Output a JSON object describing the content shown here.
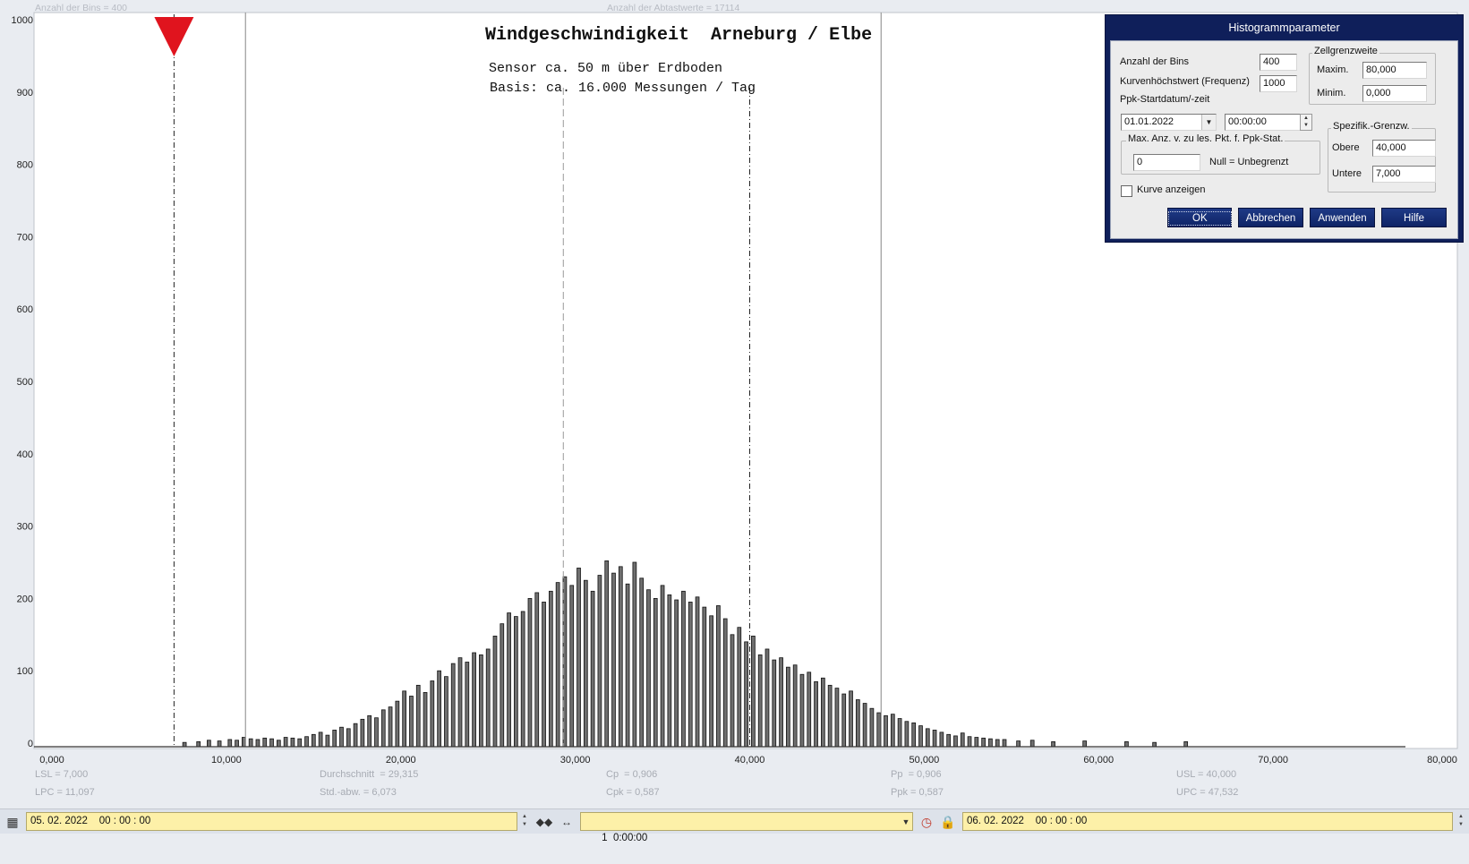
{
  "header": {
    "bins_label": "Anzahl der Bins =   400",
    "samples_label": "Anzahl der Abtastwerte = 17114"
  },
  "chart_data": {
    "type": "bar",
    "title": "Windgeschwindigkeit  Arneburg / Elbe",
    "subtitle_lines": [
      "Sensor ca. 50 m über Erdboden",
      "Basis: ca. 16.000 Messungen / Tag"
    ],
    "y_ticks": [
      "1000",
      "900",
      "800",
      "700",
      "600",
      "500",
      "400",
      "300",
      "200",
      "100",
      "0"
    ],
    "x_ticks": [
      "0,000",
      "10,000",
      "20,000",
      "30,000",
      "40,000",
      "50,000",
      "60,000",
      "70,000",
      "80,000"
    ],
    "xlim": [
      0,
      80
    ],
    "ylim": [
      0,
      1000
    ],
    "bin_width": 0.2,
    "bins": [
      {
        "x": 7.5,
        "y": 1
      },
      {
        "x": 8.3,
        "y": 2
      },
      {
        "x": 8.9,
        "y": 4
      },
      {
        "x": 9.5,
        "y": 3
      },
      {
        "x": 10.1,
        "y": 5
      },
      {
        "x": 10.5,
        "y": 4
      },
      {
        "x": 10.9,
        "y": 8
      },
      {
        "x": 11.3,
        "y": 6
      },
      {
        "x": 11.7,
        "y": 5
      },
      {
        "x": 12.1,
        "y": 7
      },
      {
        "x": 12.5,
        "y": 6
      },
      {
        "x": 12.9,
        "y": 4
      },
      {
        "x": 13.3,
        "y": 8
      },
      {
        "x": 13.7,
        "y": 7
      },
      {
        "x": 14.1,
        "y": 6
      },
      {
        "x": 14.5,
        "y": 9
      },
      {
        "x": 14.9,
        "y": 12
      },
      {
        "x": 15.3,
        "y": 15
      },
      {
        "x": 15.7,
        "y": 11
      },
      {
        "x": 16.1,
        "y": 18
      },
      {
        "x": 16.5,
        "y": 22
      },
      {
        "x": 16.9,
        "y": 20
      },
      {
        "x": 17.3,
        "y": 27
      },
      {
        "x": 17.7,
        "y": 33
      },
      {
        "x": 18.1,
        "y": 38
      },
      {
        "x": 18.5,
        "y": 35
      },
      {
        "x": 18.9,
        "y": 46
      },
      {
        "x": 19.3,
        "y": 50
      },
      {
        "x": 19.7,
        "y": 58
      },
      {
        "x": 20.1,
        "y": 72
      },
      {
        "x": 20.5,
        "y": 65
      },
      {
        "x": 20.9,
        "y": 80
      },
      {
        "x": 21.3,
        "y": 70
      },
      {
        "x": 21.7,
        "y": 86
      },
      {
        "x": 22.1,
        "y": 100
      },
      {
        "x": 22.5,
        "y": 92
      },
      {
        "x": 22.9,
        "y": 110
      },
      {
        "x": 23.3,
        "y": 118
      },
      {
        "x": 23.7,
        "y": 112
      },
      {
        "x": 24.1,
        "y": 125
      },
      {
        "x": 24.5,
        "y": 122
      },
      {
        "x": 24.9,
        "y": 130
      },
      {
        "x": 25.3,
        "y": 148
      },
      {
        "x": 25.7,
        "y": 165
      },
      {
        "x": 26.1,
        "y": 180
      },
      {
        "x": 26.5,
        "y": 175
      },
      {
        "x": 26.9,
        "y": 182
      },
      {
        "x": 27.3,
        "y": 200
      },
      {
        "x": 27.7,
        "y": 208
      },
      {
        "x": 28.1,
        "y": 195
      },
      {
        "x": 28.5,
        "y": 210
      },
      {
        "x": 28.9,
        "y": 222
      },
      {
        "x": 29.3,
        "y": 230
      },
      {
        "x": 29.7,
        "y": 218
      },
      {
        "x": 30.1,
        "y": 242
      },
      {
        "x": 30.5,
        "y": 225
      },
      {
        "x": 30.9,
        "y": 210
      },
      {
        "x": 31.3,
        "y": 232
      },
      {
        "x": 31.7,
        "y": 252
      },
      {
        "x": 32.1,
        "y": 235
      },
      {
        "x": 32.5,
        "y": 244
      },
      {
        "x": 32.9,
        "y": 220
      },
      {
        "x": 33.3,
        "y": 250
      },
      {
        "x": 33.7,
        "y": 228
      },
      {
        "x": 34.1,
        "y": 212
      },
      {
        "x": 34.5,
        "y": 200
      },
      {
        "x": 34.9,
        "y": 218
      },
      {
        "x": 35.3,
        "y": 205
      },
      {
        "x": 35.7,
        "y": 198
      },
      {
        "x": 36.1,
        "y": 210
      },
      {
        "x": 36.5,
        "y": 195
      },
      {
        "x": 36.9,
        "y": 202
      },
      {
        "x": 37.3,
        "y": 188
      },
      {
        "x": 37.7,
        "y": 176
      },
      {
        "x": 38.1,
        "y": 190
      },
      {
        "x": 38.5,
        "y": 172
      },
      {
        "x": 38.9,
        "y": 150
      },
      {
        "x": 39.3,
        "y": 160
      },
      {
        "x": 39.7,
        "y": 140
      },
      {
        "x": 40.1,
        "y": 148
      },
      {
        "x": 40.5,
        "y": 122
      },
      {
        "x": 40.9,
        "y": 130
      },
      {
        "x": 41.3,
        "y": 115
      },
      {
        "x": 41.7,
        "y": 118
      },
      {
        "x": 42.1,
        "y": 105
      },
      {
        "x": 42.5,
        "y": 108
      },
      {
        "x": 42.9,
        "y": 95
      },
      {
        "x": 43.3,
        "y": 98
      },
      {
        "x": 43.7,
        "y": 85
      },
      {
        "x": 44.1,
        "y": 90
      },
      {
        "x": 44.5,
        "y": 80
      },
      {
        "x": 44.9,
        "y": 76
      },
      {
        "x": 45.3,
        "y": 68
      },
      {
        "x": 45.7,
        "y": 72
      },
      {
        "x": 46.1,
        "y": 60
      },
      {
        "x": 46.5,
        "y": 55
      },
      {
        "x": 46.9,
        "y": 48
      },
      {
        "x": 47.3,
        "y": 42
      },
      {
        "x": 47.7,
        "y": 38
      },
      {
        "x": 48.1,
        "y": 40
      },
      {
        "x": 48.5,
        "y": 34
      },
      {
        "x": 48.9,
        "y": 30
      },
      {
        "x": 49.3,
        "y": 28
      },
      {
        "x": 49.7,
        "y": 24
      },
      {
        "x": 50.1,
        "y": 20
      },
      {
        "x": 50.5,
        "y": 18
      },
      {
        "x": 50.9,
        "y": 15
      },
      {
        "x": 51.3,
        "y": 12
      },
      {
        "x": 51.7,
        "y": 10
      },
      {
        "x": 52.1,
        "y": 14
      },
      {
        "x": 52.5,
        "y": 9
      },
      {
        "x": 52.9,
        "y": 8
      },
      {
        "x": 53.3,
        "y": 7
      },
      {
        "x": 53.7,
        "y": 6
      },
      {
        "x": 54.1,
        "y": 5
      },
      {
        "x": 54.5,
        "y": 5
      },
      {
        "x": 55.3,
        "y": 3
      },
      {
        "x": 56.1,
        "y": 4
      },
      {
        "x": 57.3,
        "y": 2
      },
      {
        "x": 59.1,
        "y": 3
      },
      {
        "x": 61.5,
        "y": 2
      },
      {
        "x": 63.1,
        "y": 1
      },
      {
        "x": 64.9,
        "y": 2
      }
    ],
    "lines": {
      "lsl": 7.0,
      "lpc": 11.097,
      "mean": 29.315,
      "usl": 40.0,
      "upc": 47.532
    },
    "marker_value": 7.0,
    "colors": {
      "bar_fill": "#6f6f6f",
      "bar_stroke": "#111111",
      "marker": "#e0141e",
      "axis": "#333333"
    }
  },
  "stats": {
    "lsl": "LSL = 7,000",
    "lpc": "LPC = 11,097",
    "mean": "Durchschnitt  = 29,315",
    "std": "Std.-abw. = 6,073",
    "cp": "Cp  = 0,906",
    "cpk": "Cpk = 0,587",
    "pp": "Pp  = 0,906",
    "ppk": "Ppk = 0,587",
    "usl": "USL = 40,000",
    "upc": "UPC = 47,532"
  },
  "dialog": {
    "title": "Histogrammparameter",
    "bins_label": "Anzahl der Bins",
    "bins_value": "400",
    "max_freq_label": "Kurvenhöchstwert (Frequenz)",
    "max_freq_value": "1000",
    "ppk_start_label": "Ppk-Startdatum/-zeit",
    "start_date": "01.01.2022",
    "start_time": "00:00:00",
    "cell_group_label": "Zellgrenzweite",
    "max_label": "Maxim.",
    "max_value": "80,000",
    "min_label": "Minim.",
    "min_value": "0,000",
    "maxpts_group_label": "Max. Anz. v. zu les. Pkt. f. Ppk-Stat.",
    "maxpts_value": "0",
    "maxpts_hint": "Null = Unbegrenzt",
    "spec_group_label": "Spezifik.-Grenzw.",
    "upper_label": "Obere",
    "upper_value": "40,000",
    "lower_label": "Untere",
    "lower_value": "7,000",
    "show_curve_label": "Kurve anzeigen",
    "btn_ok": "OK",
    "btn_cancel": "Abbrechen",
    "btn_apply": "Anwenden",
    "btn_help": "Hilfe"
  },
  "bottom": {
    "start_datetime": "05. 02. 2022    00 : 00 : 00",
    "interval": "1  0:00:00",
    "end_datetime": "06. 02. 2022    00 : 00 : 00"
  }
}
